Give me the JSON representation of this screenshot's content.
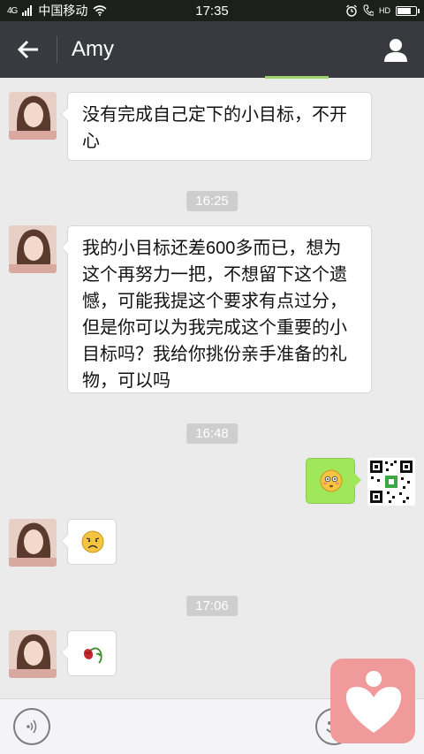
{
  "status_bar": {
    "signal": "4G",
    "carrier": "中国移动",
    "time": "17:35",
    "hd": "HD"
  },
  "header": {
    "title": "Amy"
  },
  "messages": [
    {
      "type": "in",
      "text": "没有完成自己定下的小目标，不开心"
    },
    {
      "type": "time",
      "text": "16:25"
    },
    {
      "type": "in",
      "text": "我的小目标还差600多而已，想为这个再努力一把，不想留下这个遗憾，可能我提这个要求有点过分，但是你可以为我完成这个重要的小目标吗？我给你挑份亲手准备的礼物，可以吗"
    },
    {
      "type": "time",
      "text": "16:48"
    },
    {
      "type": "out",
      "content": "flushed-emoji"
    },
    {
      "type": "in",
      "content": "sad-emoji"
    },
    {
      "type": "time",
      "text": "17:06"
    },
    {
      "type": "in",
      "content": "wilted-rose-emoji"
    }
  ],
  "colors": {
    "titlebar": "#393a3f",
    "bubble_out": "#a0e75a",
    "background": "#ebebeb"
  }
}
